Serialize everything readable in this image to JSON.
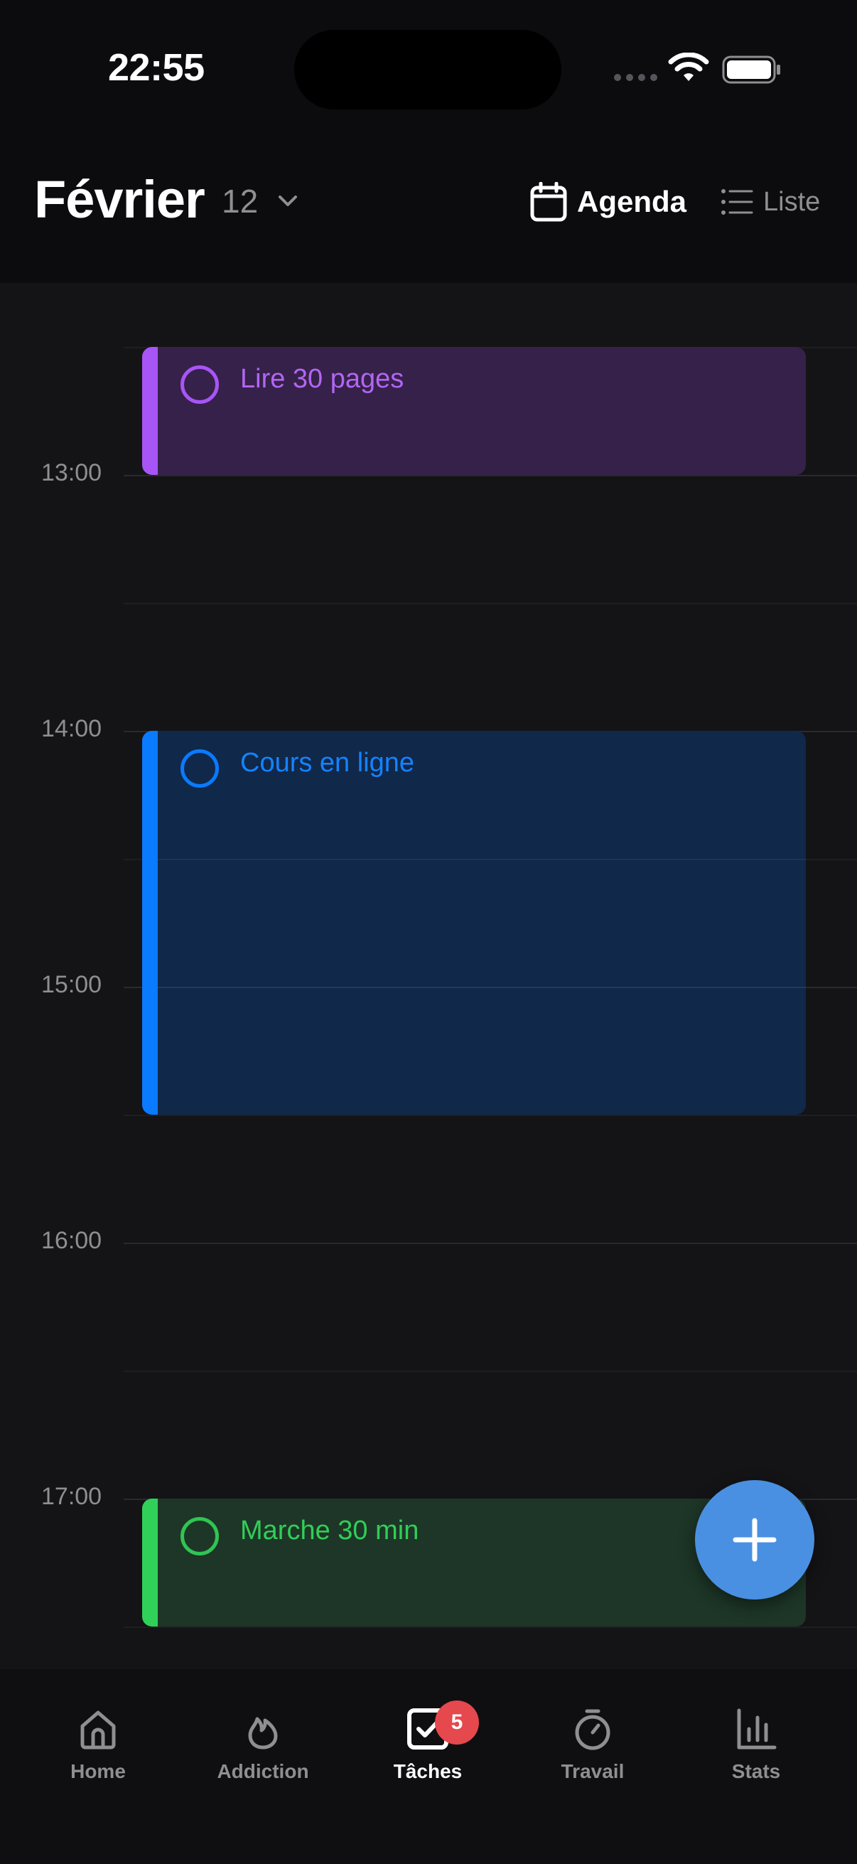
{
  "status_bar": {
    "time": "22:55"
  },
  "header": {
    "month": "Février",
    "day": "12",
    "view_agenda_label": "Agenda",
    "view_list_label": "Liste"
  },
  "timeline": {
    "hours": [
      "13:00",
      "14:00",
      "15:00",
      "16:00",
      "17:00"
    ],
    "events": [
      {
        "title": "Lire 30 pages",
        "color": "#a855f7",
        "icon": "circle-checkbox-icon"
      },
      {
        "title": "Cours en ligne",
        "color": "#0a7aff",
        "icon": "circle-checkbox-icon"
      },
      {
        "title": "Marche 30 min",
        "color": "#30d158",
        "icon": "circle-checkbox-icon"
      }
    ]
  },
  "fab": {
    "icon": "plus-icon",
    "color": "#4a90e2"
  },
  "tabbar": {
    "items": [
      {
        "label": "Home",
        "icon": "home-icon"
      },
      {
        "label": "Addiction",
        "icon": "flame-icon"
      },
      {
        "label": "Tâches",
        "icon": "checkbox-icon",
        "badge": "5"
      },
      {
        "label": "Travail",
        "icon": "stopwatch-icon"
      },
      {
        "label": "Stats",
        "icon": "bar-chart-icon"
      }
    ],
    "active": "Tâches",
    "badge_color": "#e5484d"
  }
}
